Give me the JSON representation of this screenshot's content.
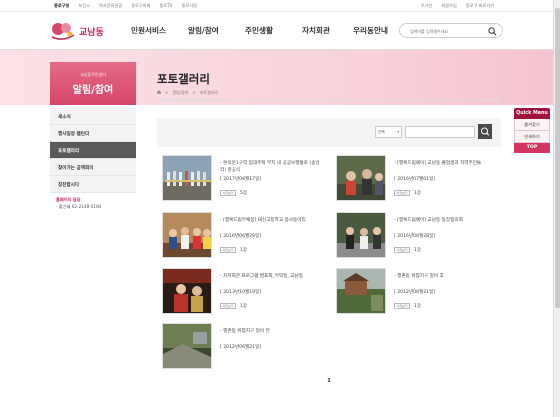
{
  "utility": {
    "home": "종로구청",
    "links": [
      "보건소",
      "역사문화관광",
      "종로구의회",
      "종로TV",
      "종로사랑"
    ],
    "right_links": [
      "로그인",
      "회원가입",
      "종로구 바로가기"
    ]
  },
  "header": {
    "logo_text": "교남동",
    "menu": [
      "민원서비스",
      "알림/참여",
      "주민생활",
      "자치회관",
      "우리동안내"
    ],
    "search_placeholder": "검색어를 입력해주세요"
  },
  "sidebar": {
    "subtitle": "교남동주민센터",
    "title": "알림/참여",
    "items": [
      {
        "label": "새소식",
        "active": false
      },
      {
        "label": "행사일정 캘린더",
        "active": false
      },
      {
        "label": "포토갤러리",
        "active": true
      },
      {
        "label": "찾아가는 금액회의",
        "active": false
      },
      {
        "label": "칭찬합시다",
        "active": false
      }
    ],
    "contact_title": "홈페이지 담당",
    "contact_line": "- 황선혜 02-2148-5184"
  },
  "page": {
    "title": "포토갤러리",
    "breadcrumb": [
      "알림/참여",
      "포토갤러리"
    ]
  },
  "filter": {
    "select_label": "선택",
    "keyword_value": ""
  },
  "gallery": [
    {
      "title": "- 돈의문1구역 임대주택 부지 내 공공보행통로 (송강각) 준공식",
      "date": "[ 2017년08월17일]",
      "tag": "사진보기",
      "count": "5장"
    },
    {
      "title": "- [행복드림페이] 교남동 졸업생과 지역주민들",
      "date": "[ 2016년07월01일]",
      "tag": "사진보기",
      "count": "1장"
    },
    {
      "title": "- [행복드림부채봉] 대신고등학교 봉사동아리",
      "date": "[ 2016년06월29일]",
      "tag": "사진보기",
      "count": "1장"
    },
    {
      "title": "- [행복드림페이] 교남동 동장협의회",
      "date": "[ 2016년06월28일]",
      "tag": "사진보기",
      "count": "1장"
    },
    {
      "title": "- 자치회관 프로그램 발표회_무악동, 교남동",
      "date": "[ 2013년10월19일]",
      "tag": "사진보기",
      "count": "1장"
    },
    {
      "title": "- 행촌동 위험지구 정비 후",
      "date": "[ 2012년06월21일]",
      "tag": "사진보기",
      "count": "1장"
    },
    {
      "title": "- 행촌동 위험지구 정비 전",
      "date": "[ 2012년06월21일]",
      "tag": "",
      "count": ""
    }
  ],
  "pagination": {
    "current": "1"
  },
  "quick_menu": {
    "title": "Quick Menu",
    "items": [
      "즐겨찾기",
      "인쇄하기"
    ],
    "top": "TOP"
  },
  "colors": {
    "brand": "#d6456a",
    "brand_dark": "#a3103c",
    "banner": "#f8d3dc"
  }
}
